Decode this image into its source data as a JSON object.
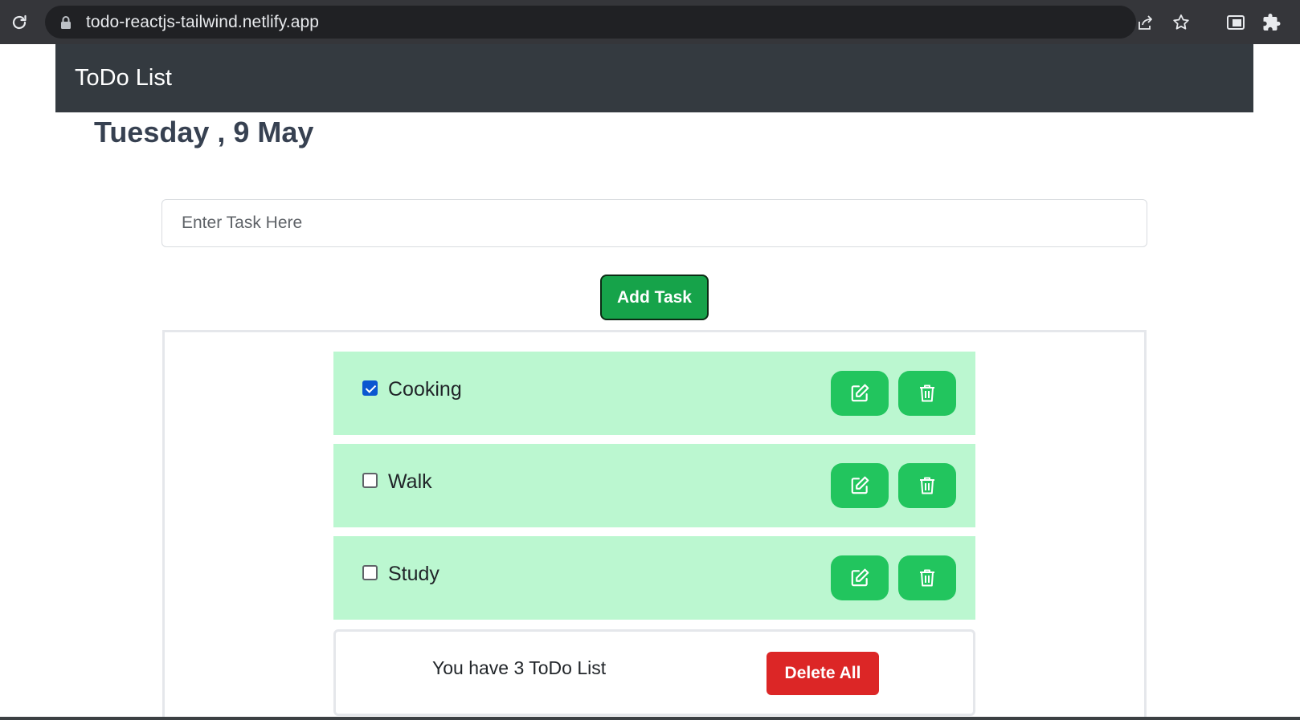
{
  "browser": {
    "url": "todo-reactjs-tailwind.netlify.app"
  },
  "navbar": {
    "brand": "ToDo List"
  },
  "date_heading": "Tuesday , 9 May",
  "task_input": {
    "placeholder": "Enter Task Here",
    "value": ""
  },
  "add_button_label": "Add Task",
  "todos": [
    {
      "label": "Cooking",
      "checked": true
    },
    {
      "label": "Walk",
      "checked": false
    },
    {
      "label": "Study",
      "checked": false
    }
  ],
  "footer": {
    "count_text": "You have 3 ToDo List",
    "delete_all_label": "Delete All"
  },
  "colors": {
    "navbar": "#343a40",
    "item_background": "#bbf7d0",
    "icon_button": "#22c55e",
    "add_button": "#16a34a",
    "delete_all": "#dc2626"
  },
  "icons": {
    "edit": "edit-icon",
    "delete": "trash-icon"
  }
}
